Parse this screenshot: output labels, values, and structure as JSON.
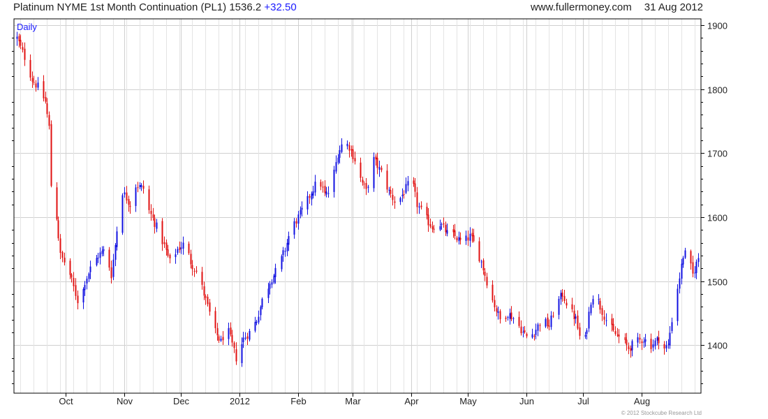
{
  "header": {
    "instrument": "Platinum NYME 1st Month Continuation (PL1)",
    "last_price": "1536.2",
    "change": "+32.50",
    "site": "www.fullermoney.com",
    "date": "31 Aug 2012"
  },
  "footer": {
    "copyright": "© 2012 Stockcube Research Ltd"
  },
  "colors": {
    "up": "#1010e0",
    "down": "#e01010",
    "grid": "#d0d0d0",
    "axis": "#000000",
    "period_label": "#1a1aff"
  },
  "chart_data": {
    "type": "candlestick",
    "period_label": "Daily",
    "ylim": [
      1325,
      1910
    ],
    "yticks": [
      1400,
      1500,
      1600,
      1700,
      1800,
      1900
    ],
    "ytick_labels": [
      "1400",
      "1500",
      "1600",
      "1700",
      "1800",
      "1900"
    ],
    "x_range": [
      "2011-09-05",
      "2012-08-31"
    ],
    "xticks": [
      {
        "date": "2011-10-01",
        "label": "Oct"
      },
      {
        "date": "2011-11-01",
        "label": "Nov"
      },
      {
        "date": "2011-12-01",
        "label": "Dec"
      },
      {
        "date": "2012-01-01",
        "label": "2012"
      },
      {
        "date": "2012-02-01",
        "label": "Feb"
      },
      {
        "date": "2012-03-01",
        "label": "Mar"
      },
      {
        "date": "2012-04-01",
        "label": "Apr"
      },
      {
        "date": "2012-05-01",
        "label": "May"
      },
      {
        "date": "2012-06-01",
        "label": "Jun"
      },
      {
        "date": "2012-07-01",
        "label": "Jul"
      },
      {
        "date": "2012-08-01",
        "label": "Aug"
      }
    ],
    "close_path": [
      [
        "2011-09-05",
        1880
      ],
      [
        "2011-09-09",
        1850
      ],
      [
        "2011-09-13",
        1815
      ],
      [
        "2011-09-17",
        1800
      ],
      [
        "2011-09-20",
        1780
      ],
      [
        "2011-09-22",
        1740
      ],
      [
        "2011-09-23",
        1650
      ],
      [
        "2011-09-26",
        1600
      ],
      [
        "2011-09-28",
        1540
      ],
      [
        "2011-10-02",
        1520
      ],
      [
        "2011-10-05",
        1490
      ],
      [
        "2011-10-08",
        1460
      ],
      [
        "2011-10-11",
        1500
      ],
      [
        "2011-10-14",
        1520
      ],
      [
        "2011-10-18",
        1540
      ],
      [
        "2011-10-22",
        1550
      ],
      [
        "2011-10-25",
        1510
      ],
      [
        "2011-10-28",
        1580
      ],
      [
        "2011-10-31",
        1640
      ],
      [
        "2011-11-04",
        1620
      ],
      [
        "2011-11-07",
        1650
      ],
      [
        "2011-11-11",
        1645
      ],
      [
        "2011-11-14",
        1610
      ],
      [
        "2011-11-18",
        1585
      ],
      [
        "2011-11-22",
        1555
      ],
      [
        "2011-11-25",
        1530
      ],
      [
        "2011-11-29",
        1550
      ],
      [
        "2011-12-03",
        1560
      ],
      [
        "2011-12-06",
        1530
      ],
      [
        "2011-12-10",
        1510
      ],
      [
        "2011-12-13",
        1480
      ],
      [
        "2011-12-16",
        1450
      ],
      [
        "2011-12-19",
        1420
      ],
      [
        "2011-12-22",
        1405
      ],
      [
        "2011-12-25",
        1430
      ],
      [
        "2011-12-28",
        1400
      ],
      [
        "2011-12-30",
        1380
      ],
      [
        "2012-01-03",
        1410
      ],
      [
        "2012-01-06",
        1420
      ],
      [
        "2012-01-10",
        1440
      ],
      [
        "2012-01-13",
        1470
      ],
      [
        "2012-01-17",
        1500
      ],
      [
        "2012-01-21",
        1520
      ],
      [
        "2012-01-25",
        1550
      ],
      [
        "2012-01-28",
        1580
      ],
      [
        "2012-02-01",
        1600
      ],
      [
        "2012-02-05",
        1620
      ],
      [
        "2012-02-08",
        1640
      ],
      [
        "2012-02-12",
        1660
      ],
      [
        "2012-02-15",
        1635
      ],
      [
        "2012-02-18",
        1640
      ],
      [
        "2012-02-22",
        1700
      ],
      [
        "2012-02-25",
        1720
      ],
      [
        "2012-02-28",
        1710
      ],
      [
        "2012-03-02",
        1690
      ],
      [
        "2012-03-05",
        1660
      ],
      [
        "2012-03-08",
        1640
      ],
      [
        "2012-03-12",
        1690
      ],
      [
        "2012-03-16",
        1670
      ],
      [
        "2012-03-20",
        1640
      ],
      [
        "2012-03-24",
        1620
      ],
      [
        "2012-03-28",
        1640
      ],
      [
        "2012-04-01",
        1660
      ],
      [
        "2012-04-04",
        1620
      ],
      [
        "2012-04-08",
        1600
      ],
      [
        "2012-04-12",
        1585
      ],
      [
        "2012-04-16",
        1590
      ],
      [
        "2012-04-20",
        1575
      ],
      [
        "2012-04-24",
        1570
      ],
      [
        "2012-04-28",
        1560
      ],
      [
        "2012-05-02",
        1570
      ],
      [
        "2012-05-05",
        1555
      ],
      [
        "2012-05-08",
        1530
      ],
      [
        "2012-05-11",
        1500
      ],
      [
        "2012-05-14",
        1470
      ],
      [
        "2012-05-18",
        1440
      ],
      [
        "2012-05-22",
        1450
      ],
      [
        "2012-05-26",
        1440
      ],
      [
        "2012-05-30",
        1420
      ],
      [
        "2012-06-02",
        1410
      ],
      [
        "2012-06-06",
        1425
      ],
      [
        "2012-06-09",
        1440
      ],
      [
        "2012-06-13",
        1430
      ],
      [
        "2012-06-16",
        1460
      ],
      [
        "2012-06-20",
        1480
      ],
      [
        "2012-06-23",
        1460
      ],
      [
        "2012-06-27",
        1440
      ],
      [
        "2012-06-30",
        1400
      ],
      [
        "2012-07-02",
        1410
      ],
      [
        "2012-07-05",
        1470
      ],
      [
        "2012-07-07",
        1485
      ],
      [
        "2012-07-10",
        1460
      ],
      [
        "2012-07-13",
        1440
      ],
      [
        "2012-07-17",
        1420
      ],
      [
        "2012-07-21",
        1410
      ],
      [
        "2012-07-25",
        1395
      ],
      [
        "2012-07-29",
        1405
      ],
      [
        "2012-08-02",
        1410
      ],
      [
        "2012-08-06",
        1400
      ],
      [
        "2012-08-10",
        1410
      ],
      [
        "2012-08-13",
        1395
      ],
      [
        "2012-08-15",
        1400
      ],
      [
        "2012-08-17",
        1440
      ],
      [
        "2012-08-20",
        1490
      ],
      [
        "2012-08-23",
        1540
      ],
      [
        "2012-08-25",
        1545
      ],
      [
        "2012-08-28",
        1510
      ],
      [
        "2012-08-31",
        1536.2
      ]
    ]
  }
}
